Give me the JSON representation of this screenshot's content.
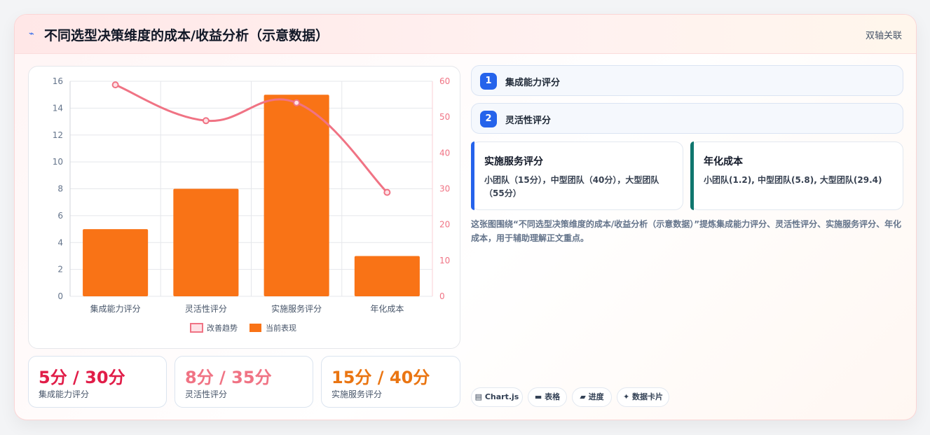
{
  "header": {
    "icon": "lightning-icon",
    "title": "不同选型决策维度的成本/收益分析（示意数据）",
    "right_label": "双轴关联"
  },
  "chart_data": {
    "type": "bar",
    "categories": [
      "集成能力评分",
      "灵活性评分",
      "实施服务评分",
      "年化成本"
    ],
    "series": [
      {
        "name": "当前表现",
        "type": "bar",
        "axis": "left",
        "values": [
          5,
          8,
          15,
          3
        ],
        "color": "#f97316"
      },
      {
        "name": "改善趋势",
        "type": "line",
        "axis": "right",
        "values": [
          59,
          49,
          54,
          29
        ],
        "color": "#f07384"
      }
    ],
    "y_left": {
      "ticks": [
        "0",
        "2",
        "4",
        "6",
        "8",
        "10",
        "12",
        "14",
        "16"
      ],
      "ylim": [
        0,
        16
      ]
    },
    "y_right": {
      "ticks": [
        "0",
        "10",
        "20",
        "30",
        "40",
        "50",
        "60"
      ],
      "ylim": [
        0,
        60
      ]
    },
    "legend": {
      "position": "bottom",
      "items": [
        "改善趋势",
        "当前表现"
      ]
    },
    "grid": true
  },
  "stats": [
    {
      "value": "5分 / 30分",
      "label": "集成能力评分",
      "color": "#e11d48"
    },
    {
      "value": "8分 / 35分",
      "label": "灵活性评分",
      "color": "#f07384"
    },
    {
      "value": "15分 / 40分",
      "label": "实施服务评分",
      "color": "#ea7512"
    }
  ],
  "steps": [
    {
      "num": "1",
      "label": "集成能力评分"
    },
    {
      "num": "2",
      "label": "灵活性评分"
    }
  ],
  "info_cards": [
    {
      "title": "实施服务评分",
      "body": "小团队（15分），中型团队（40分），大型团队（55分）",
      "accent": "#2563eb"
    },
    {
      "title": "年化成本",
      "body": "小团队(1.2), 中型团队(5.8), 大型团队(29.4)",
      "accent": "#0f766e"
    }
  ],
  "description": "这张图围绕“不同选型决策维度的成本/收益分析（示意数据）”提炼集成能力评分、灵活性评分、实施服务评分、年化成本，用于辅助理解正文重点。",
  "tags": [
    {
      "icon": "chart-icon",
      "label": "▤ Chart.js"
    },
    {
      "icon": "table-icon",
      "label": "▬ 表格"
    },
    {
      "icon": "folder-icon",
      "label": "▰ 进度"
    },
    {
      "icon": "sparkle-icon",
      "label": "✦ 数据卡片"
    }
  ]
}
